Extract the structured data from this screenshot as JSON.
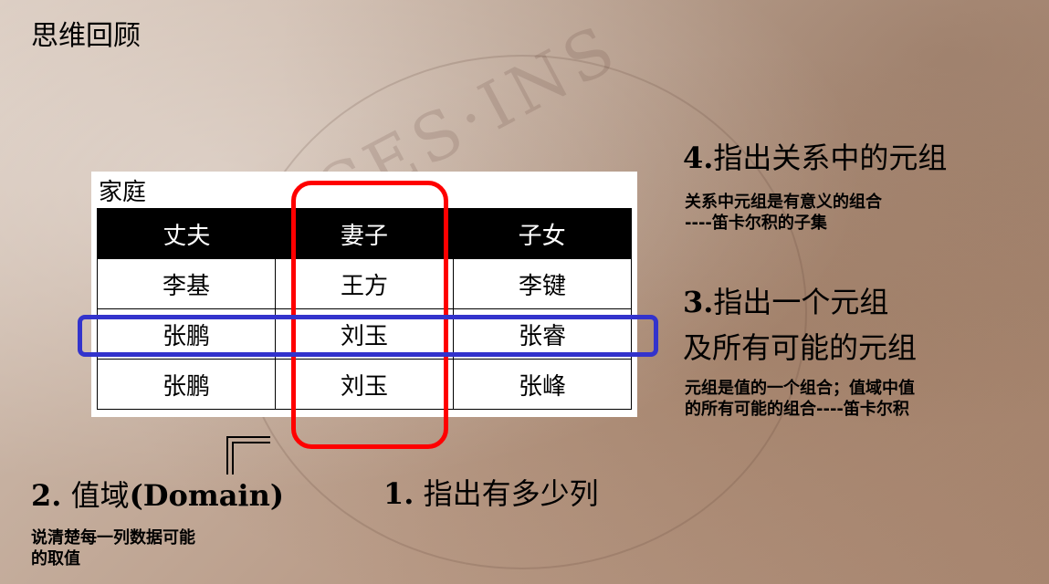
{
  "heading": "思维回顾",
  "watermark": "CES·INS",
  "table": {
    "caption": "家庭",
    "headers": [
      "丈夫",
      "妻子",
      "子女"
    ],
    "rows": [
      [
        "李基",
        "王方",
        "李键"
      ],
      [
        "张鹏",
        "刘玉",
        "张睿"
      ],
      [
        "张鹏",
        "刘玉",
        "张峰"
      ]
    ]
  },
  "annotations": {
    "point4": {
      "num": "4.",
      "title": "指出关系中的元组",
      "desc_line1": "关系中元组是有意义的组合",
      "desc_line2": "----笛卡尔积的子集"
    },
    "point3": {
      "num": "3.",
      "title_line1": "指出一个元组",
      "title_line2": "及所有可能的元组",
      "desc_line1": "元组是值的一个组合；值域中值",
      "desc_line2": "的所有可能的组合----笛卡尔积"
    },
    "point2": {
      "num": "2.",
      "title": "值域",
      "title_en": "(Domain)",
      "desc_line1": "说清楚每一列数据可能",
      "desc_line2": "的取值"
    },
    "point1": {
      "num": "1.",
      "title": "指出有多少列"
    }
  },
  "colors": {
    "column_highlight": "#ff0000",
    "row_highlight": "#3333cc",
    "header_bg": "#000000"
  }
}
